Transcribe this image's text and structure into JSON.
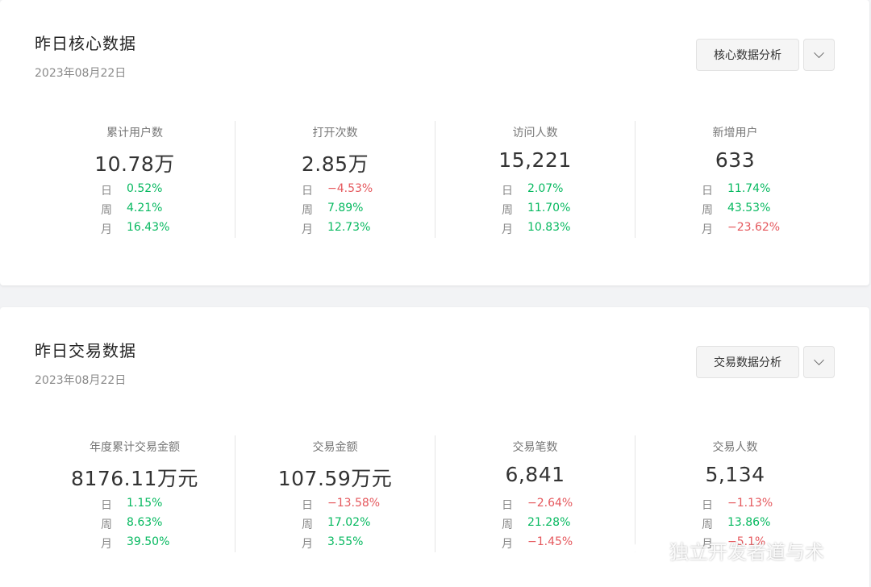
{
  "core": {
    "title": "昨日核心数据",
    "date": "2023年08月22日",
    "analysis_label": "核心数据分析",
    "metrics": [
      {
        "label": "累计用户数",
        "value": "10.78万",
        "changes": [
          {
            "period": "日",
            "value": "0.52%",
            "trend": "up"
          },
          {
            "period": "周",
            "value": "4.21%",
            "trend": "up"
          },
          {
            "period": "月",
            "value": "16.43%",
            "trend": "up"
          }
        ]
      },
      {
        "label": "打开次数",
        "value": "2.85万",
        "changes": [
          {
            "period": "日",
            "value": "−4.53%",
            "trend": "down"
          },
          {
            "period": "周",
            "value": "7.89%",
            "trend": "up"
          },
          {
            "period": "月",
            "value": "12.73%",
            "trend": "up"
          }
        ]
      },
      {
        "label": "访问人数",
        "value": "15,221",
        "changes": [
          {
            "period": "日",
            "value": "2.07%",
            "trend": "up"
          },
          {
            "period": "周",
            "value": "11.70%",
            "trend": "up"
          },
          {
            "period": "月",
            "value": "10.83%",
            "trend": "up"
          }
        ]
      },
      {
        "label": "新增用户",
        "value": "633",
        "changes": [
          {
            "period": "日",
            "value": "11.74%",
            "trend": "up"
          },
          {
            "period": "周",
            "value": "43.53%",
            "trend": "up"
          },
          {
            "period": "月",
            "value": "−23.62%",
            "trend": "down"
          }
        ]
      }
    ]
  },
  "trade": {
    "title": "昨日交易数据",
    "date": "2023年08月22日",
    "analysis_label": "交易数据分析",
    "metrics": [
      {
        "label": "年度累计交易金额",
        "value": "8176.11万元",
        "changes": [
          {
            "period": "日",
            "value": "1.15%",
            "trend": "up"
          },
          {
            "period": "周",
            "value": "8.63%",
            "trend": "up"
          },
          {
            "period": "月",
            "value": "39.50%",
            "trend": "up"
          }
        ]
      },
      {
        "label": "交易金额",
        "value": "107.59万元",
        "changes": [
          {
            "period": "日",
            "value": "−13.58%",
            "trend": "down"
          },
          {
            "period": "周",
            "value": "17.02%",
            "trend": "up"
          },
          {
            "period": "月",
            "value": "3.55%",
            "trend": "up"
          }
        ]
      },
      {
        "label": "交易笔数",
        "value": "6,841",
        "changes": [
          {
            "period": "日",
            "value": "−2.64%",
            "trend": "down"
          },
          {
            "period": "周",
            "value": "21.28%",
            "trend": "up"
          },
          {
            "period": "月",
            "value": "−1.45%",
            "trend": "down"
          }
        ]
      },
      {
        "label": "交易人数",
        "value": "5,134",
        "changes": [
          {
            "period": "日",
            "value": "−1.13%",
            "trend": "down"
          },
          {
            "period": "周",
            "value": "13.86%",
            "trend": "up"
          },
          {
            "period": "月",
            "value": "−5.1%",
            "trend": "down"
          }
        ]
      }
    ]
  },
  "watermark": {
    "text": "独立开发者道与术",
    "icon": "wechat-icon"
  },
  "colors": {
    "up": "#07b960",
    "down": "#e5585d"
  }
}
